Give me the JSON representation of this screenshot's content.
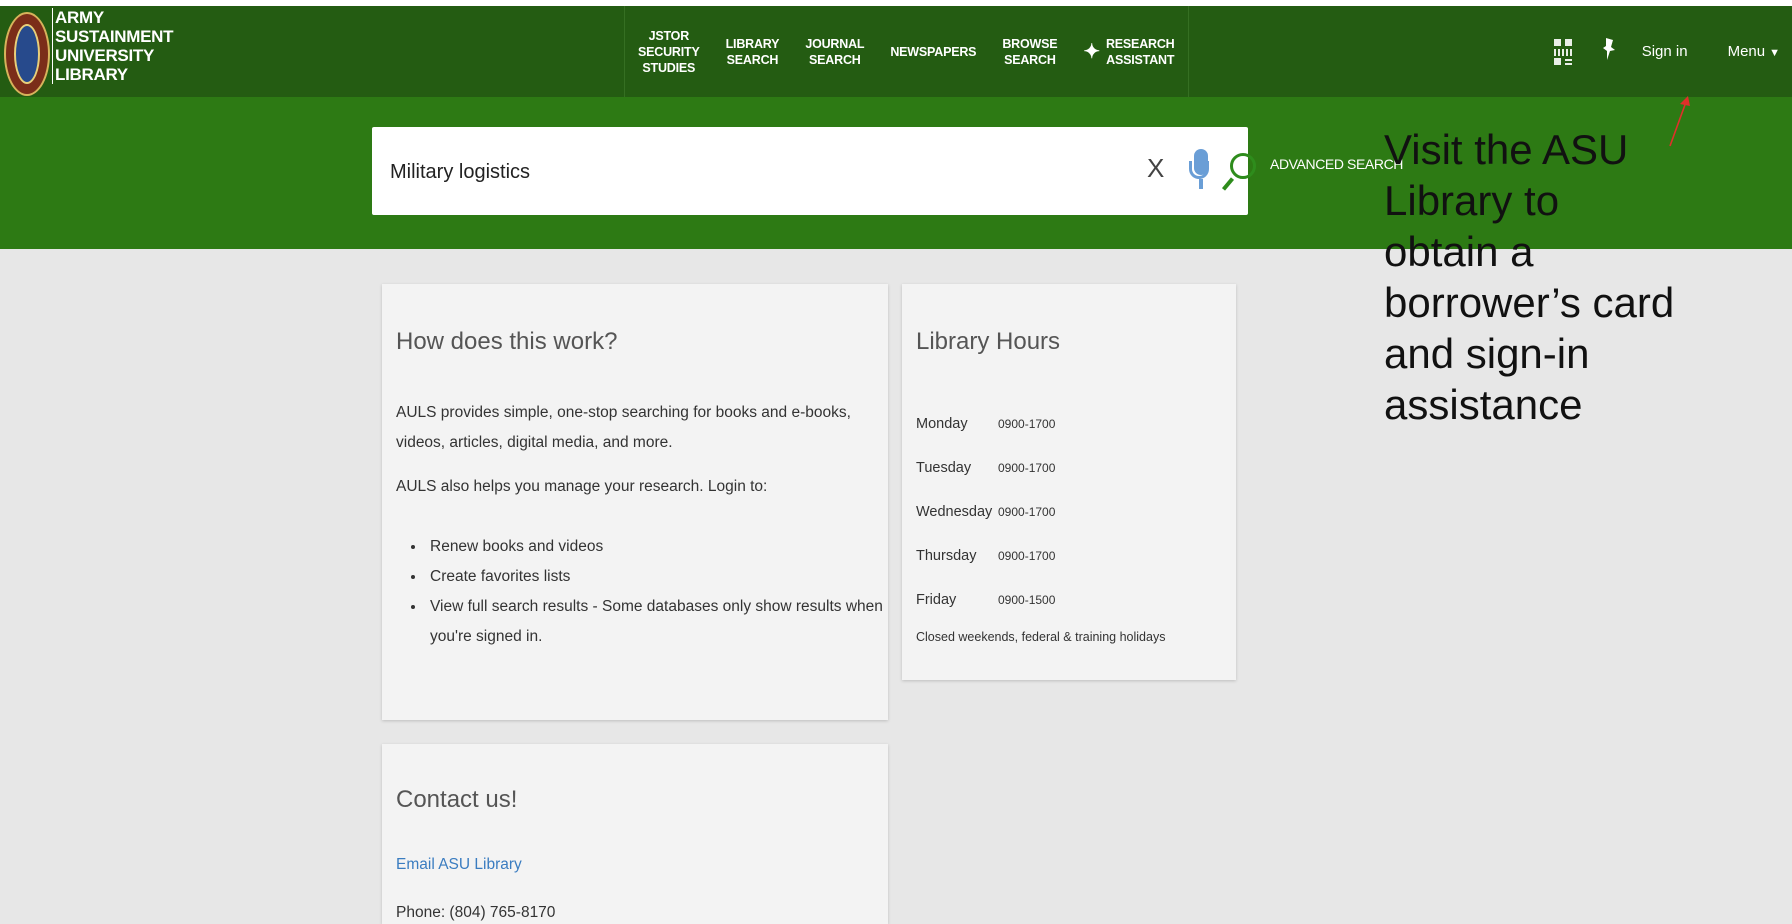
{
  "header": {
    "logo_lines": [
      "ARMY",
      "SUSTAINMENT",
      "UNIVERSITY",
      "LIBRARY"
    ],
    "nav": [
      {
        "label": "JSTOR\nSECURITY\nSTUDIES"
      },
      {
        "label": "LIBRARY\nSEARCH"
      },
      {
        "label": "JOURNAL\nSEARCH"
      },
      {
        "label": "NEWSPAPERS"
      },
      {
        "label": "BROWSE\nSEARCH"
      },
      {
        "label": "RESEARCH\nASSISTANT"
      }
    ],
    "sign_in": "Sign in",
    "menu": "Menu"
  },
  "search": {
    "value": "Military logistics",
    "clear": "X",
    "advanced": "ADVANCED SEARCH"
  },
  "annotation": {
    "text": "Visit the ASU Library to obtain a borrower’s card and sign-in assistance",
    "color": "#e0302a"
  },
  "how_it_works": {
    "title": "How does this work?",
    "p1": "AULS provides simple, one-stop searching for books and e-books, videos, articles, digital media, and more.",
    "p2": "AULS also helps you manage your research. Login to:",
    "bullets": [
      "Renew books and videos",
      "Create favorites lists",
      "View full search results - Some databases only show results when you're signed in."
    ]
  },
  "hours": {
    "title": "Library Hours",
    "rows": [
      {
        "day": "Monday",
        "time": "0900-1700"
      },
      {
        "day": "Tuesday",
        "time": "0900-1700"
      },
      {
        "day": "Wednesday",
        "time": "0900-1700"
      },
      {
        "day": "Thursday",
        "time": "0900-1700"
      },
      {
        "day": "Friday",
        "time": "0900-1500"
      }
    ],
    "note": "Closed weekends, federal & training holidays"
  },
  "contact": {
    "title": "Contact us!",
    "email": "Email ASU Library",
    "phone": "Phone: (804) 765-8170"
  },
  "colors": {
    "header_bg": "#245c12",
    "search_band_bg": "#2d7a14",
    "link": "#3a7cc0"
  }
}
